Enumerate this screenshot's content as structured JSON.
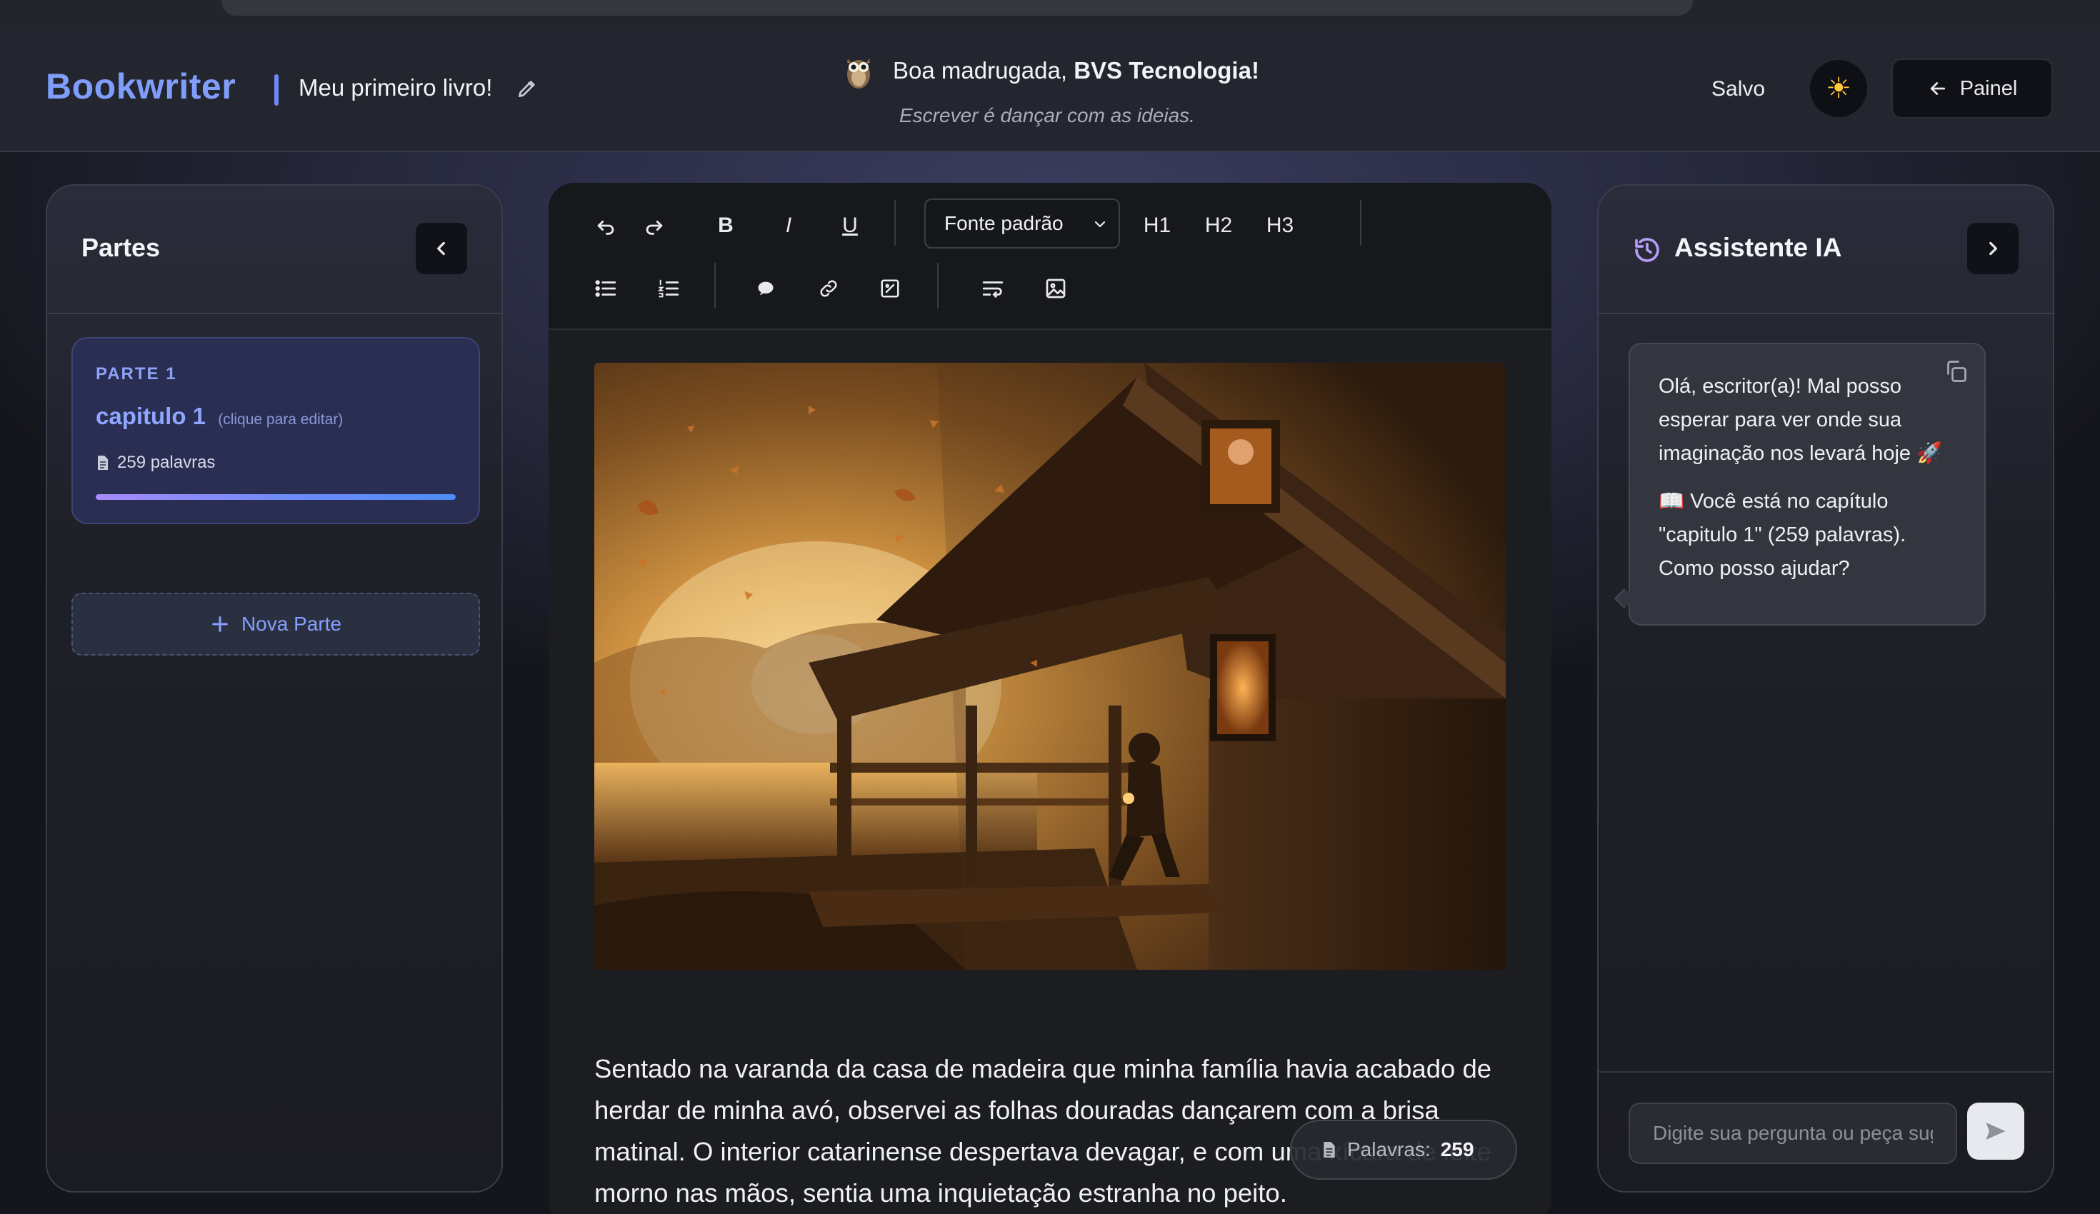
{
  "header": {
    "brand": "Bookwriter",
    "book_title": "Meu primeiro livro!",
    "greeting_prefix": "Boa madrugada,",
    "greeting_name": "BVS Tecnologia!",
    "tagline": "Escrever é dançar com as ideias.",
    "save_status": "Salvo",
    "theme_toggle_glyph": "☀",
    "panel_button": "Painel"
  },
  "parts_panel": {
    "title": "Partes",
    "parts": [
      {
        "label": "PARTE 1",
        "chapter": "capitulo 1",
        "hint": "(clique para editar)",
        "words": "259 palavras",
        "progress": 1.0
      }
    ],
    "new_part_label": "Nova Parte"
  },
  "toolbar": {
    "font_select": "Fonte padrão",
    "bold": "B",
    "italic": "I",
    "underline": "U",
    "h1": "H1",
    "h2": "H2",
    "h3": "H3"
  },
  "editor": {
    "paragraph": "Sentado na varanda da casa de madeira que minha família havia acabado de herdar de minha avó, observei as folhas douradas dançarem com a brisa matinal. O interior catarinense despertava devagar, e com uma xícara de leite morno nas mãos, sentia uma inquietação estranha no peito.",
    "word_count_label": "Palavras:",
    "word_count": "259"
  },
  "assistant": {
    "title": "Assistente IA",
    "message_1": "Olá, escritor(a)! Mal posso esperar para ver onde sua imaginação nos levará hoje 🚀",
    "message_2": "📖 Você está no capítulo \"capitulo 1\" (259 palavras). Como posso ajudar?",
    "input_placeholder": "Digite sua pergunta ou peça sugestões..."
  },
  "colors": {
    "accent": "#7f9dfa",
    "background": "#15161c",
    "card": "#2a2e52"
  }
}
